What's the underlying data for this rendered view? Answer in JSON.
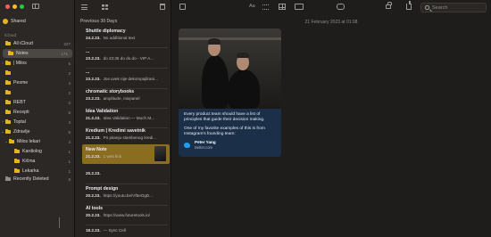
{
  "sidebar": {
    "shared": {
      "label": "Shared"
    },
    "section": "iCloud",
    "items": [
      {
        "label": "All iCloud",
        "count": "227"
      },
      {
        "label": "Notes",
        "count": "171"
      },
      {
        "label": "| Milos",
        "count": "5"
      },
      {
        "label": "",
        "count": "2"
      },
      {
        "label": "Pesme",
        "count": "4"
      },
      {
        "label": "",
        "count": "2"
      },
      {
        "label": "REBT",
        "count": "2"
      },
      {
        "label": "Recepti",
        "count": "6"
      },
      {
        "label": "Toptal",
        "count": "3"
      },
      {
        "label": "Zdravlje",
        "count": "6"
      },
      {
        "label": "Milos lekari",
        "count": "4"
      },
      {
        "label": "Kardiolog",
        "count": "1"
      },
      {
        "label": "Kičma",
        "count": "1"
      },
      {
        "label": "Lekarka",
        "count": "1"
      },
      {
        "label": "Recently Deleted",
        "count": "8"
      }
    ]
  },
  "notelist": {
    "section": "Previous 30 Days",
    "notes": [
      {
        "title": "Shuttle diplomacy",
        "date": "24.2.23.",
        "preview": "No additional text"
      },
      {
        "title": "...",
        "date": "23.2.23.",
        "preview": "do 23:36 do do do - VIP A..."
      },
      {
        "title": "...",
        "date": "23.2.23.",
        "preview": "Jos uvek nije dekompajlirani..."
      },
      {
        "title": "chromatic storybooks",
        "date": "23.2.23.",
        "preview": "amplitude, mixpanel"
      },
      {
        "title": "Idea Validation",
        "date": "21.2.23.",
        "preview": "Idea Validation — Much M..."
      },
      {
        "title": "Kredium | Kredimi savetnik",
        "date": "21.2.23.",
        "preview": "Po pitanju stambenog kredi..."
      },
      {
        "title": "New Note",
        "date": "21.2.23.",
        "preview": "1 web link"
      },
      {
        "title": "",
        "date": "20.2.23.",
        "preview": ""
      },
      {
        "title": "Prompt design",
        "date": "20.2.23.",
        "preview": "https://youtu.be/Vf5eOgD..."
      },
      {
        "title": "AI tools",
        "date": "20.2.23.",
        "preview": "https://www.futuretools.io/"
      },
      {
        "title": "",
        "date": "18.2.23.",
        "preview": "— Sync Cell"
      }
    ]
  },
  "editor": {
    "date": "21 February 2023 at 01:08",
    "aa": "Aa",
    "search_placeholder": "Search",
    "card": {
      "para1": "Every product team should have a list of principles that guide their decision making.",
      "para2": "One of my favorite examples of this is from Instagram's founding team:",
      "author": "Peter Yang",
      "site": "twitter.com"
    }
  },
  "colors": {
    "accent": "#e6b422",
    "selected_note": "#8a6d1f",
    "card_bg": "#1b2f48"
  }
}
